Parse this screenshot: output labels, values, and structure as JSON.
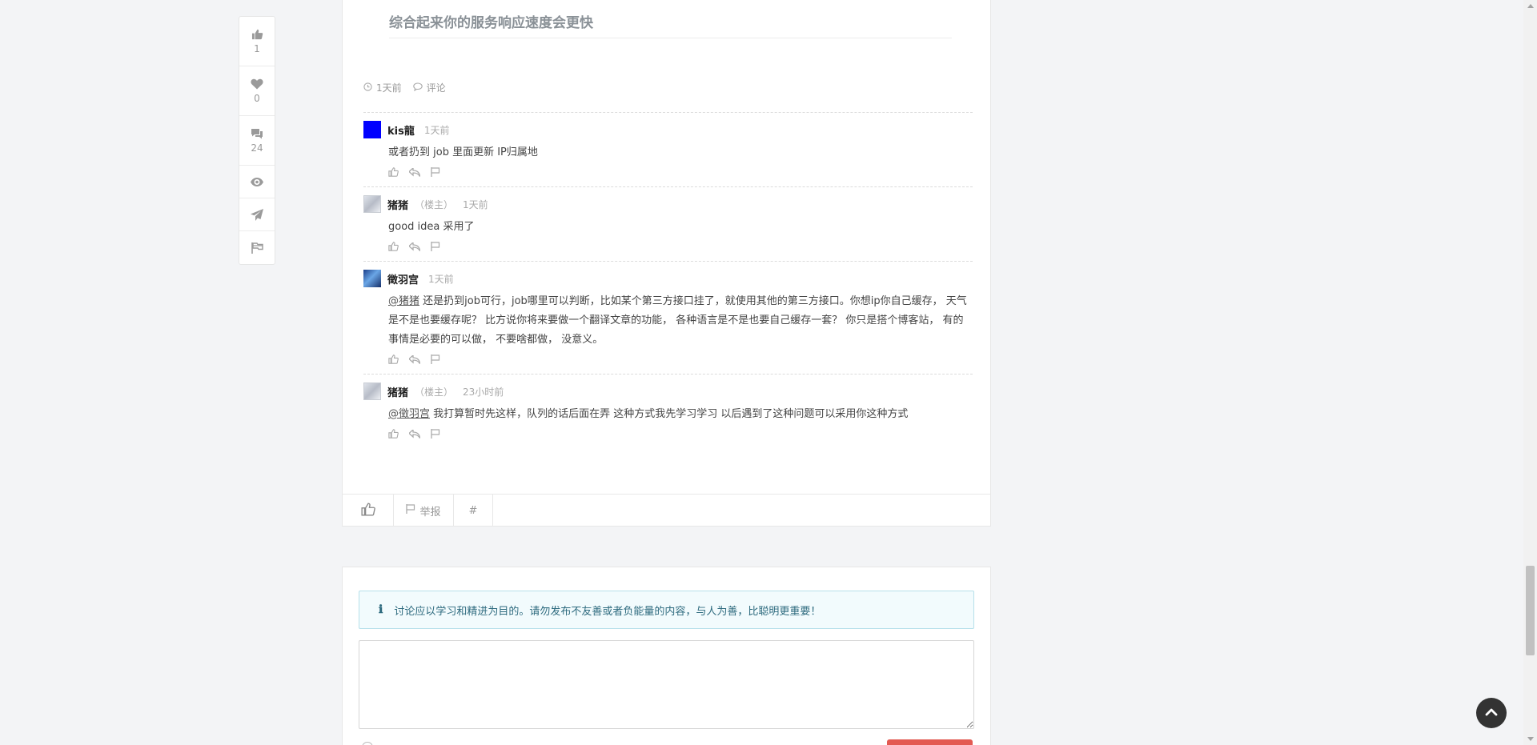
{
  "rail": {
    "like_count": "1",
    "favorite_count": "0",
    "comment_count": "24"
  },
  "post": {
    "heading": "综合起来你的服务响应速度会更快",
    "meta_time": "1天前",
    "meta_comment": "评论"
  },
  "comments": [
    {
      "name": "kis龍",
      "owner": "",
      "time": "1天前",
      "mention": "",
      "text": "或者扔到 job 里面更新 IP归属地"
    },
    {
      "name": "猪猪",
      "owner": "（楼主）",
      "time": "1天前",
      "mention": "",
      "text": "good idea 采用了"
    },
    {
      "name": "徵羽宫",
      "owner": "",
      "time": "1天前",
      "mention": "@猪猪",
      "text": " 还是扔到job可行，job哪里可以判断，比如某个第三方接口挂了，就使用其他的第三方接口。你想ip你自己缓存， 天气是不是也要缓存呢？ 比方说你将来要做一个翻译文章的功能， 各种语言是不是也要自己缓存一套？ 你只是搭个博客站， 有的事情是必要的可以做， 不要啥都做， 没意义。"
    },
    {
      "name": "猪猪",
      "owner": "（楼主）",
      "time": "23小时前",
      "mention": "@徵羽宫",
      "text": " 我打算暂时先这样，队列的话后面在弄 这种方式我先学习学习 以后遇到了这种问题可以采用你这种方式"
    }
  ],
  "footer": {
    "report_label": "举报",
    "hash_label": "#"
  },
  "reply": {
    "notice_icon": "ℹ",
    "notice_text": "讨论应以学习和精进为目的。请勿发布不友善或者负能量的内容，与人为善，比聪明更重要！",
    "placeholder": ""
  },
  "colors": {
    "accent_submit": "#e35a52",
    "notice_bg": "#f2fbfd",
    "notice_text": "#2d6a7e"
  }
}
